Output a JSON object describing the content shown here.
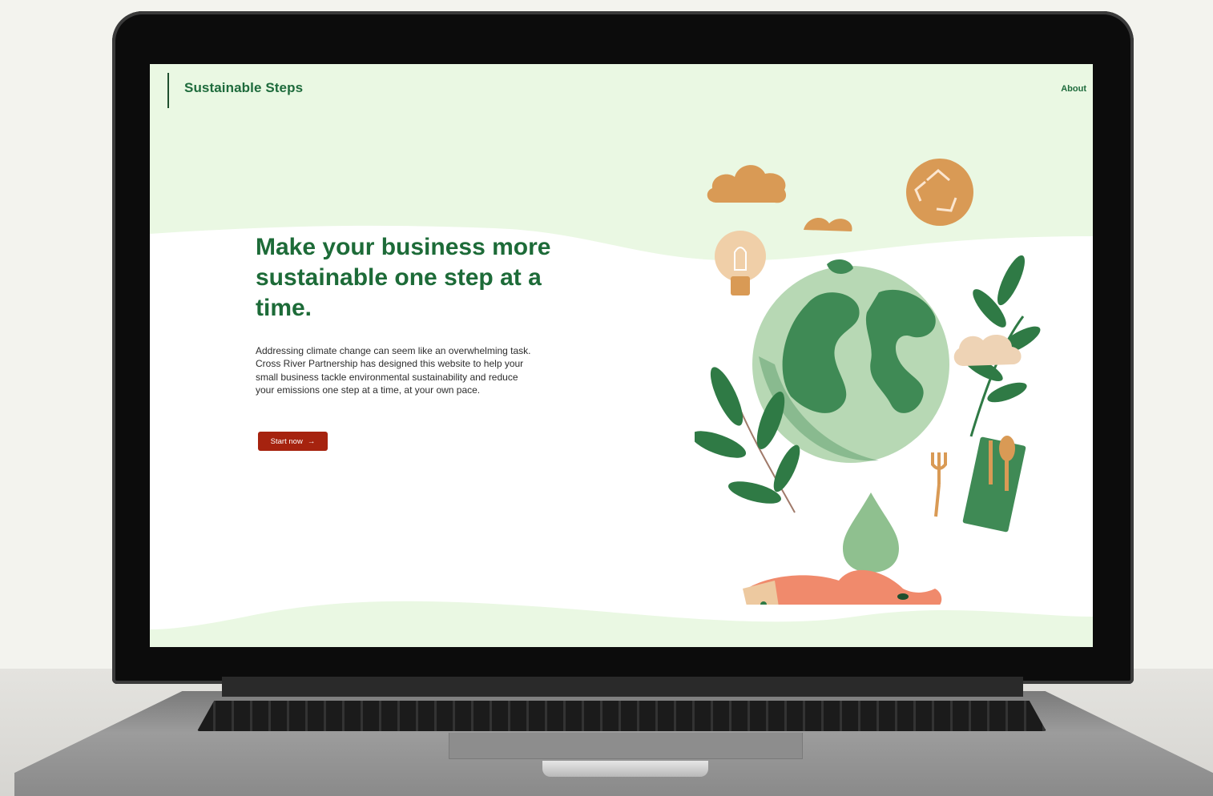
{
  "site": {
    "brand": "Sustainable Steps",
    "nav": {
      "about": "About"
    }
  },
  "hero": {
    "title": "Make your business more sustainable one step at a time.",
    "body": "Addressing climate change can seem like an overwhelming task. Cross River Partnership has designed this website to help your small business tackle environmental sustainability and reduce your emissions one step at a time, at your own pace.",
    "cta_label": "Start now",
    "cta_icon": "arrow-right-icon"
  },
  "colors": {
    "brand_green": "#1d6b38",
    "page_mint": "#eaf8e3",
    "cta_red": "#a6230f"
  }
}
